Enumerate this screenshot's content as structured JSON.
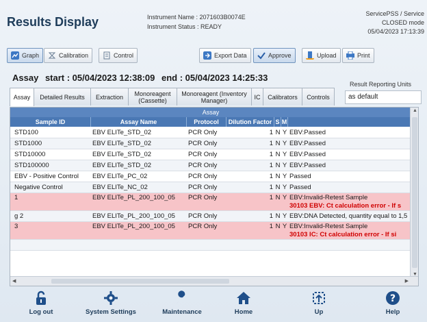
{
  "header": {
    "title": "Results Display",
    "instrument_name": "Instrument Name : 2071603B0074E",
    "instrument_status": "Instrument Status : READY",
    "user": "ServicePSS / Service",
    "mode": "CLOSED mode",
    "datetime": "05/04/2023 17:13:39"
  },
  "toolbar": {
    "graph": "Graph",
    "calibration": "Calibration",
    "control": "Control",
    "export": "Export Data",
    "approve": "Approve",
    "upload": "Upload",
    "print": "Print"
  },
  "assay_line": {
    "label": "Assay",
    "start": "start : 05/04/2023 12:38:09",
    "end": "end : 05/04/2023 14:25:33"
  },
  "reporting_units": {
    "label": "Result Reporting Units",
    "value": "as default"
  },
  "tabs": [
    {
      "label": "Assay"
    },
    {
      "label": "Detailed Results"
    },
    {
      "label": "Extraction"
    },
    {
      "label": "Monoreagent (Cassette)"
    },
    {
      "label": "Monoreagent (Inventory Manager)"
    },
    {
      "label": "IC"
    },
    {
      "label": "Calibrators"
    },
    {
      "label": "Controls"
    }
  ],
  "table": {
    "group_header": "Assay",
    "columns": [
      "Sample ID",
      "Assay Name",
      "Protocol",
      "Dilution Factor",
      "S",
      "M"
    ],
    "rows": [
      {
        "sample_id": "STD100",
        "assay": "EBV ELITe_STD_02",
        "protocol": "PCR Only",
        "dilution": "1",
        "s": "N",
        "m": "Y",
        "result": "EBV:Passed",
        "error": ""
      },
      {
        "sample_id": "STD1000",
        "assay": "EBV ELITe_STD_02",
        "protocol": "PCR Only",
        "dilution": "1",
        "s": "N",
        "m": "Y",
        "result": "EBV:Passed",
        "error": ""
      },
      {
        "sample_id": "STD10000",
        "assay": "EBV ELITe_STD_02",
        "protocol": "PCR Only",
        "dilution": "1",
        "s": "N",
        "m": "Y",
        "result": "EBV:Passed",
        "error": ""
      },
      {
        "sample_id": "STD100000",
        "assay": "EBV ELITe_STD_02",
        "protocol": "PCR Only",
        "dilution": "1",
        "s": "N",
        "m": "Y",
        "result": "EBV:Passed",
        "error": ""
      },
      {
        "sample_id": "EBV - Positive Control",
        "assay": "EBV ELITe_PC_02",
        "protocol": "PCR Only",
        "dilution": "1",
        "s": "N",
        "m": "Y",
        "result": "Passed",
        "error": ""
      },
      {
        "sample_id": "Negative Control",
        "assay": "EBV ELITe_NC_02",
        "protocol": "PCR Only",
        "dilution": "1",
        "s": "N",
        "m": "Y",
        "result": "Passed",
        "error": ""
      },
      {
        "sample_id": "1",
        "assay": "EBV ELITe_PL_200_100_05",
        "protocol": "PCR Only",
        "dilution": "1",
        "s": "N",
        "m": "Y",
        "result": "EBV:Invalid-Retest Sample",
        "error": "30103 EBV: Ct calculation error - If s"
      },
      {
        "sample_id": "g 2",
        "assay": "EBV ELITe_PL_200_100_05",
        "protocol": "PCR Only",
        "dilution": "1",
        "s": "N",
        "m": "Y",
        "result": "EBV:DNA Detected, quantity equal to 1,5",
        "error": ""
      },
      {
        "sample_id": "3",
        "assay": "EBV ELITe_PL_200_100_05",
        "protocol": "PCR Only",
        "dilution": "1",
        "s": "N",
        "m": "Y",
        "result": "EBV:Invalid-Retest Sample",
        "error": "30103 IC: Ct calculation error - If si"
      }
    ]
  },
  "nav": [
    {
      "label": "Log out",
      "icon": "lock-icon"
    },
    {
      "label": "System Settings",
      "icon": "gear-icon"
    },
    {
      "label": "Maintenance",
      "icon": "wrench-icon"
    },
    {
      "label": "Home",
      "icon": "home-icon"
    },
    {
      "label": "Up",
      "icon": "upload-icon"
    },
    {
      "label": "Help",
      "icon": "help-icon"
    }
  ],
  "colors": {
    "header_blue": "#4a78b4",
    "error_row": "#f7c4c8",
    "error_text": "#d00000",
    "nav_icon": "#1f4f8a"
  }
}
